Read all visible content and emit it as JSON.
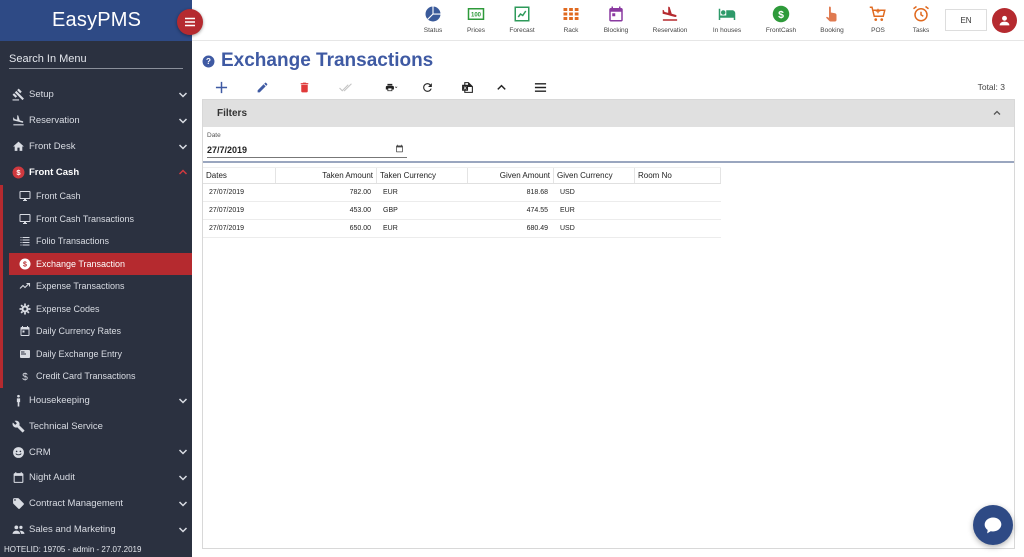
{
  "app": {
    "title": "EasyPMS"
  },
  "sidebar": {
    "search_placeholder": "Search In Menu",
    "items": [
      {
        "label": "Setup",
        "icon": "gavel-icon"
      },
      {
        "label": "Reservation",
        "icon": "plane-landing-icon"
      },
      {
        "label": "Front Desk",
        "icon": "home-icon"
      },
      {
        "label": "Front Cash",
        "icon": "dollar-circle-icon"
      },
      {
        "label": "Housekeeping",
        "icon": "person-icon"
      },
      {
        "label": "Technical Service",
        "icon": "wrench-icon"
      },
      {
        "label": "CRM",
        "icon": "smile-icon"
      },
      {
        "label": "Night Audit",
        "icon": "calendar-icon"
      },
      {
        "label": "Contract Management",
        "icon": "tag-icon"
      },
      {
        "label": "Sales and Marketing",
        "icon": "group-icon"
      }
    ],
    "sub_items": [
      {
        "label": "Front Cash",
        "icon": "monitor-icon"
      },
      {
        "label": "Front Cash Transactions",
        "icon": "monitor-icon"
      },
      {
        "label": "Folio Transactions",
        "icon": "list-icon"
      },
      {
        "label": "Exchange Transaction",
        "icon": "dollar-circle-icon"
      },
      {
        "label": "Expense Transactions",
        "icon": "trend-icon"
      },
      {
        "label": "Expense Codes",
        "icon": "gear-icon"
      },
      {
        "label": "Daily Currency Rates",
        "icon": "calendar-icon"
      },
      {
        "label": "Daily Exchange Entry",
        "icon": "card-icon"
      },
      {
        "label": "Credit Card Transactions",
        "icon": "dollar-icon"
      }
    ],
    "footer": "HOTELID: 19705 - admin - 27.07.2019"
  },
  "topbar": {
    "items": [
      {
        "label": "Status",
        "icon": "pie-icon",
        "color": "#3a5a9a"
      },
      {
        "label": "Prices",
        "icon": "prices-icon",
        "color": "#2e9a3a"
      },
      {
        "label": "Forecast",
        "icon": "chart-icon",
        "color": "#2e9a5a"
      },
      {
        "label": "Rack",
        "icon": "grid-icon",
        "color": "#e06a20"
      },
      {
        "label": "Blocking",
        "icon": "calendar-icon",
        "color": "#8a3aa0"
      },
      {
        "label": "Reservation",
        "icon": "plane-landing-icon",
        "color": "#b52a2f"
      },
      {
        "label": "In houses",
        "icon": "bed-icon",
        "color": "#2e9a6a"
      },
      {
        "label": "FrontCash",
        "icon": "dollar-circle-icon",
        "color": "#2e9a3a"
      },
      {
        "label": "Booking",
        "icon": "hand-icon",
        "color": "#e07a50"
      },
      {
        "label": "POS",
        "icon": "cart-icon",
        "color": "#e06a20"
      },
      {
        "label": "Tasks",
        "icon": "alarm-icon",
        "color": "#e06a20"
      }
    ],
    "language": "EN"
  },
  "page": {
    "title": "Exchange Transactions",
    "total": "Total: 3"
  },
  "filters": {
    "title": "Filters",
    "date_label": "Date",
    "date_value": "27/7/2019"
  },
  "grid": {
    "columns": [
      "Dates",
      "Taken Amount",
      "Taken Currency",
      "Given Amount",
      "Given Currency",
      "Room No"
    ],
    "rows": [
      [
        "27/07/2019",
        "782.00",
        "EUR",
        "818.68",
        "USD",
        ""
      ],
      [
        "27/07/2019",
        "453.00",
        "GBP",
        "474.55",
        "EUR",
        ""
      ],
      [
        "27/07/2019",
        "650.00",
        "EUR",
        "680.49",
        "USD",
        ""
      ]
    ]
  },
  "colors": {
    "brand": "#2e4a85",
    "accent": "#b52a2f",
    "sidebar_bg": "#2b3140",
    "title": "#3f5aa3"
  }
}
